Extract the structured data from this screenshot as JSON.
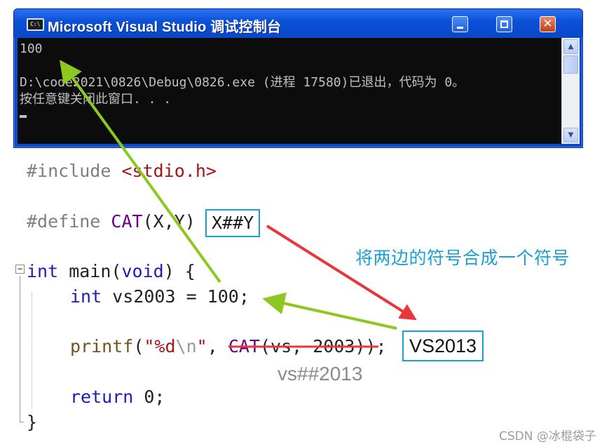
{
  "console": {
    "title": "Microsoft Visual Studio 调试控制台",
    "icon_label": "C:\\",
    "lines": [
      "100",
      "",
      "D:\\code2021\\0826\\Debug\\0826.exe (进程 17580)已退出，代码为 0。",
      "按任意键关闭此窗口. . ."
    ],
    "buttons": {
      "minimize": "minimize",
      "maximize": "maximize",
      "close": "✕"
    },
    "scroll": {
      "up": "▲",
      "down": "▼"
    }
  },
  "code": {
    "l1_pp": "#include ",
    "l1_inc": "<stdio.h>",
    "l2_pp": "#define ",
    "l2_mac": "CAT",
    "l2_params": "(X,Y) ",
    "l3_kw": "int",
    "l3_rest": " main(",
    "l3_void": "void",
    "l3_end": ") {",
    "l4_kw": "int",
    "l4_rest": " vs2003 = 100;",
    "l5_fn": "printf",
    "l5_open": "(",
    "l5_str1": "\"%d",
    "l5_esc": "\\n",
    "l5_str2": "\"",
    "l5_comma": ", ",
    "l5_mac": "CAT",
    "l5_args": "(vs, 2003)",
    "l5_end": "); ",
    "l6_kw": "return",
    "l6_rest": " 0;",
    "l7": "}",
    "fold": "−"
  },
  "annotations": {
    "macro_body": "X##Y",
    "result": "VS2013",
    "note": "将两边的符号合成一个符号",
    "concat": "vs##2013",
    "watermark": "CSDN @冰棍袋子"
  },
  "colors": {
    "keyword": "#1d1db8",
    "macro": "#6f008a",
    "string": "#a31515",
    "annotation_box": "#1aa0d8",
    "arrow_green": "#8cc820",
    "arrow_red": "#e8363a"
  }
}
